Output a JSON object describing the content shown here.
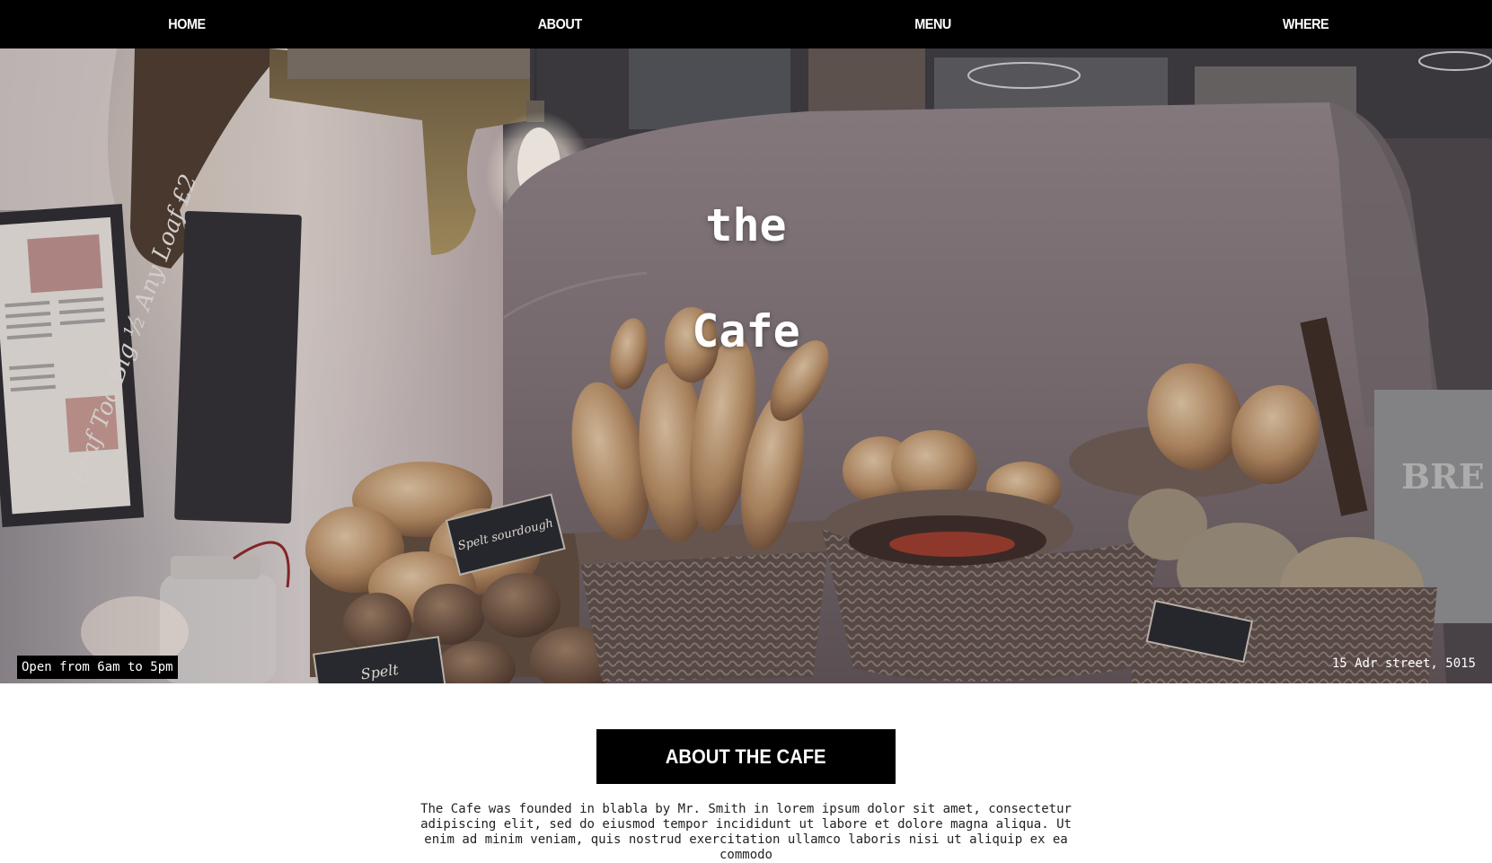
{
  "nav": {
    "items": [
      {
        "label": "HOME"
      },
      {
        "label": "ABOUT"
      },
      {
        "label": "MENU"
      },
      {
        "label": "WHERE"
      }
    ]
  },
  "hero": {
    "title_line1": "the",
    "title_line2": "Cafe",
    "hours": "Open from 6am to 5pm",
    "address": "15 Adr street, 5015",
    "chalkboard_text": "Loaf Too Big ½ Any Loaf £2",
    "sign_spelt_sourdough": "Spelt sourdough",
    "sign_spelt": "Spelt",
    "sign_wall": "BRE"
  },
  "about": {
    "heading": "ABOUT THE CAFE",
    "body": "The Cafe was founded in blabla by Mr. Smith in lorem ipsum dolor sit amet, consectetur adipiscing elit, sed do eiusmod tempor incididunt ut labore et dolore magna aliqua. Ut enim ad minim veniam, quis nostrud exercitation ullamco laboris nisi ut aliquip ex ea commodo"
  },
  "colors": {
    "nav_bg": "#000000",
    "nav_text": "#ffffff",
    "page_bg": "#ffffff",
    "heading_bg": "#000000"
  }
}
